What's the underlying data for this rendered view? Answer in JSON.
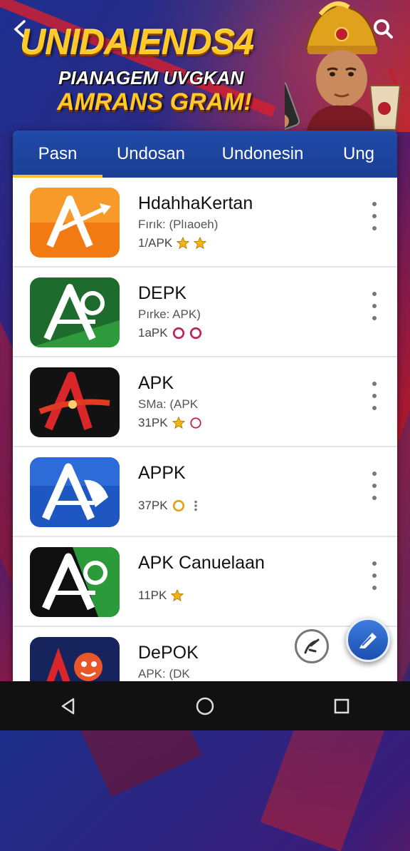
{
  "banner": {
    "title": "UNIDAIENDS4",
    "subtitle_line1": "PIANAGEM UVGKAN",
    "subtitle_line2": "AMRANS GRAM!",
    "back_icon": "back-arrow-icon",
    "search_icon": "search-icon"
  },
  "tabs": [
    {
      "label": "Pasn",
      "active": true
    },
    {
      "label": "Undosan",
      "active": false
    },
    {
      "label": "Undonesin",
      "active": false
    },
    {
      "label": "Ung",
      "active": false
    }
  ],
  "apps": [
    {
      "name": "HdahhaKertan",
      "subtitle": "Fırık: (Plıaoeh)",
      "meta": "1/APK",
      "icon_bg": "#f27a12",
      "badges": [
        "star",
        "star"
      ]
    },
    {
      "name": "DEPK",
      "subtitle": "Pırke: APK)",
      "meta": "1aPK",
      "icon_bg": "#1d6b2d",
      "badges": [
        "ring",
        "ring"
      ]
    },
    {
      "name": "APK",
      "subtitle": "SMa: (APK",
      "meta": "31PK",
      "icon_bg": "#121212",
      "badges": [
        "star",
        "ring"
      ]
    },
    {
      "name": "APPK",
      "subtitle": "",
      "meta": "37PK",
      "icon_bg": "#1f57c2",
      "badges": [
        "ring",
        "dots"
      ]
    },
    {
      "name": "APK Canuelaan",
      "subtitle": "",
      "meta": "11PK",
      "icon_bg": "#0f0f0f",
      "badges": [
        "star"
      ]
    },
    {
      "name": "DePOK",
      "subtitle": "APK: (DK",
      "meta": "",
      "icon_bg": "#17235c",
      "badges": []
    }
  ],
  "fab_small_icon": "run-icon",
  "fab_main_icon": "edit-icon",
  "navbar": {
    "back_icon": "nav-back-icon",
    "home_icon": "nav-home-icon",
    "recents_icon": "nav-recents-icon"
  },
  "colors": {
    "tab_bar": "#1f4aa8",
    "tab_indicator": "#f6c02a",
    "banner_gold": "#ffc928",
    "fab": "#2a64c8"
  }
}
